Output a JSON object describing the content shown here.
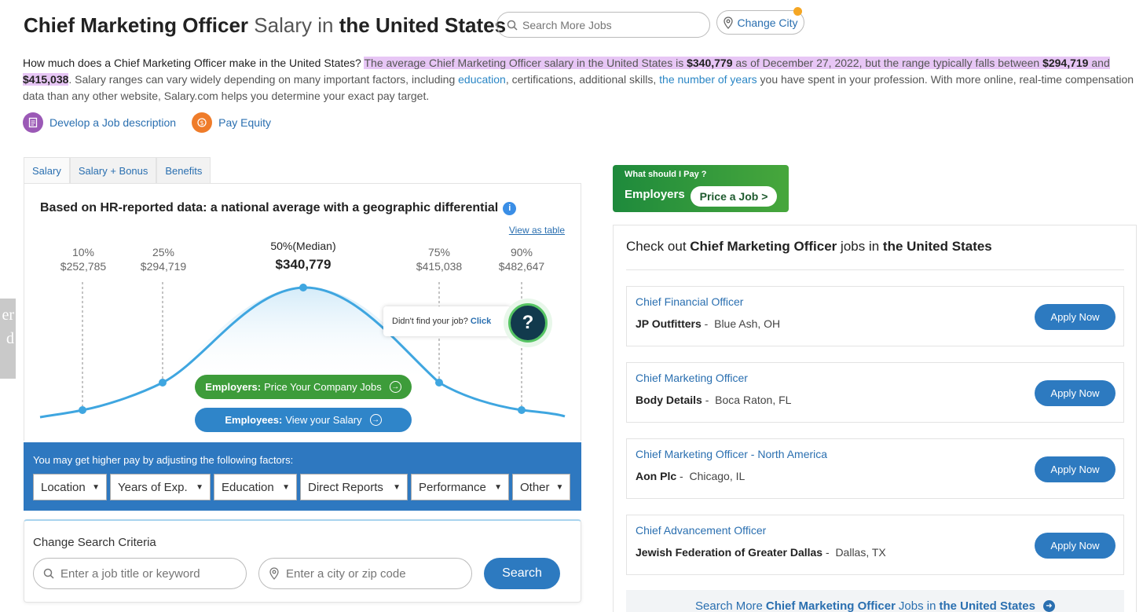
{
  "header": {
    "title_job": "Chief Marketing Officer",
    "title_salary": "Salary",
    "title_in": "in",
    "title_location": "the United States",
    "search_placeholder": "Search More Jobs",
    "change_city_label": "Change City"
  },
  "intro": {
    "question": "How much does a Chief Marketing Officer make in the United States?",
    "hl_1": "The average Chief Marketing Officer salary in the United States is ",
    "avg": "$340,779",
    "hl_2": " as of December 27, 2022, but the range typically falls between ",
    "low": "$294,719",
    "and_text": " and ",
    "high": "$415,038",
    "rest_1": ". Salary ranges can vary widely depending on many important factors, including ",
    "link_education": "education",
    "rest_2": ", certifications, additional skills, ",
    "link_years": "the number of years",
    "rest_3": " you have spent in your profession. With more online, real-time compensation data than any other website, Salary.com helps you determine your exact pay target."
  },
  "quick_links": [
    {
      "label": "Develop a Job description",
      "color": "#9b59b6",
      "icon": "document-icon"
    },
    {
      "label": "Pay Equity",
      "color": "#ef7c2a",
      "icon": "balance-icon"
    }
  ],
  "tabs": [
    "Salary",
    "Salary + Bonus",
    "Benefits"
  ],
  "chart": {
    "heading": "Based on HR-reported data: a national average with a geographic differential",
    "view_as_table": "View as table",
    "percentiles": [
      {
        "label": "10%",
        "value": "$252,785"
      },
      {
        "label": "25%",
        "value": "$294,719"
      },
      {
        "label": "50%(Median)",
        "value": "$340,779"
      },
      {
        "label": "75%",
        "value": "$415,038"
      },
      {
        "label": "90%",
        "value": "$482,647"
      }
    ],
    "cta_employers_bold": "Employers:",
    "cta_employers_text": "Price Your Company Jobs",
    "cta_employees_bold": "Employees:",
    "cta_employees_text": "View your Salary",
    "didnt_find": "Didn't find your job?",
    "click": "Click",
    "accent": "#3fa6e0"
  },
  "factors": {
    "title": "You may get higher pay by adjusting the following factors:",
    "options": [
      "Location",
      "Years of Exp.",
      "Education",
      "Direct Reports",
      "Performance",
      "Other"
    ]
  },
  "criteria": {
    "title": "Change Search Criteria",
    "job_placeholder": "Enter a job title or keyword",
    "city_placeholder": "Enter a city or zip code",
    "search_label": "Search"
  },
  "side_tab": {
    "line1": "er",
    "line2": "d"
  },
  "price_job": {
    "small": "What should I Pay ?",
    "employers": "Employers",
    "button": "Price a Job >"
  },
  "jobs": {
    "heading_pre": "Check out ",
    "heading_job": "Chief Marketing Officer",
    "heading_mid": " jobs in ",
    "heading_loc": "the United States",
    "apply_label": "Apply Now",
    "list": [
      {
        "title": "Chief Financial Officer",
        "company": "JP Outfitters",
        "location": "Blue Ash, OH"
      },
      {
        "title": "Chief Marketing Officer",
        "company": "Body Details",
        "location": "Boca Raton, FL"
      },
      {
        "title": "Chief Marketing Officer - North America",
        "company": "Aon Plc",
        "location": "Chicago, IL"
      },
      {
        "title": "Chief Advancement Officer",
        "company": "Jewish Federation of Greater Dallas",
        "location": "Dallas, TX"
      }
    ],
    "more_pre": "Search More ",
    "more_job": "Chief Marketing Officer",
    "more_mid": " Jobs in ",
    "more_loc": "the United States"
  }
}
